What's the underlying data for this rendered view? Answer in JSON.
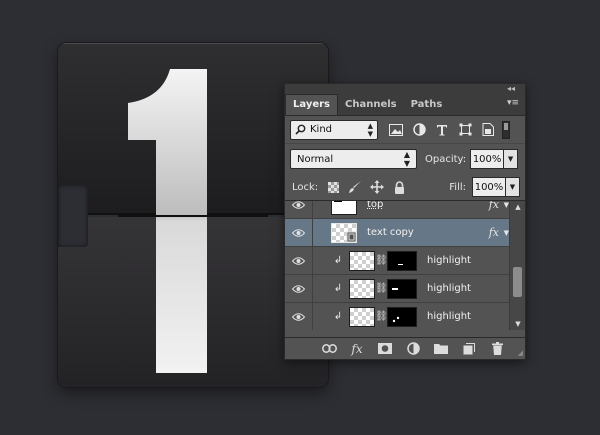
{
  "tile": {
    "digit": "1",
    "colors": {
      "top": "#201f21",
      "bottom": "#2c2b2e",
      "digit": "#f2f2f2"
    }
  },
  "panel": {
    "collapse_glyph": "◂◂",
    "tabs": [
      {
        "label": "Layers",
        "active": true
      },
      {
        "label": "Channels",
        "active": false
      },
      {
        "label": "Paths",
        "active": false
      }
    ],
    "menu_glyph": "▾≡",
    "filter": {
      "kind_label": "Kind",
      "icons": [
        "image-filter-icon",
        "adjustment-filter-icon",
        "type-filter-icon",
        "shape-filter-icon",
        "smart-object-filter-icon"
      ]
    },
    "blend_mode": "Normal",
    "opacity_label": "Opacity:",
    "opacity_value": "100%",
    "lock_label": "Lock:",
    "fill_label": "Fill:",
    "fill_value": "100%",
    "layers": [
      {
        "name": "top",
        "fx": "fx",
        "selected": false,
        "clipped": false,
        "mask": false
      },
      {
        "name": "text copy",
        "fx": "fx",
        "selected": true,
        "clipped": false,
        "mask": false
      },
      {
        "name": "highlight",
        "fx": "",
        "selected": false,
        "clipped": true,
        "mask": true
      },
      {
        "name": "highlight",
        "fx": "",
        "selected": false,
        "clipped": true,
        "mask": true
      },
      {
        "name": "highlight",
        "fx": "",
        "selected": false,
        "clipped": true,
        "mask": true
      }
    ],
    "bottom_icons": [
      "link-layers-icon",
      "fx-icon",
      "add-mask-icon",
      "adjustment-layer-icon",
      "new-group-icon",
      "new-layer-icon",
      "delete-layer-icon"
    ],
    "accent": "#667788"
  }
}
